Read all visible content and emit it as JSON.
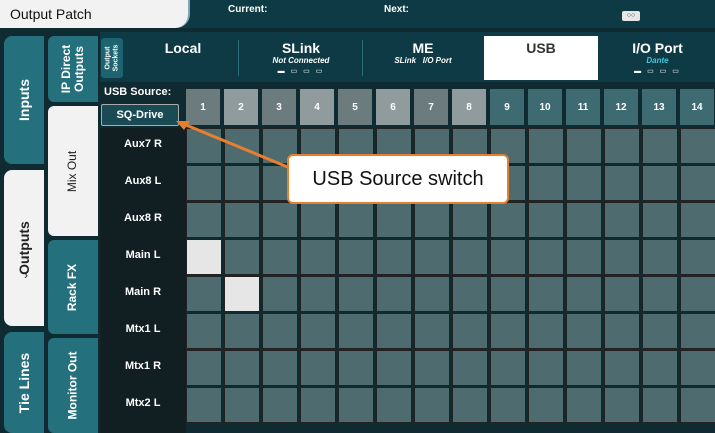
{
  "header": {
    "title": "Output Patch",
    "current_label": "Current:",
    "next_label": "Next:",
    "scene_icon": "scene-icon"
  },
  "main_tabs": [
    {
      "label": "Inputs",
      "active": false
    },
    {
      "label": "Outputs",
      "active": true
    },
    {
      "label": "Tie Lines",
      "active": false
    }
  ],
  "sub_tabs": [
    {
      "label": "IP Direct Outputs",
      "active": false
    },
    {
      "label": "Mix Out",
      "active": true
    },
    {
      "label": "Rack FX",
      "active": false
    },
    {
      "label": "Monitor Out",
      "active": false
    }
  ],
  "sockets_label": "Output Sockets",
  "socket_tabs": [
    {
      "name": "Local",
      "sub": "",
      "active": false
    },
    {
      "name": "SLink",
      "sub": "Not Connected",
      "active": false
    },
    {
      "name": "ME",
      "sub": "SLink   I/O Port",
      "active": false
    },
    {
      "name": "USB",
      "sub": "",
      "active": true
    },
    {
      "name": "I/O Port",
      "sub": "Dante",
      "active": false
    }
  ],
  "usb_source": {
    "label": "USB Source:",
    "value": "SQ-Drive"
  },
  "columns": [
    "1",
    "2",
    "3",
    "4",
    "5",
    "6",
    "7",
    "8",
    "9",
    "10",
    "11",
    "12",
    "13",
    "14"
  ],
  "rows": [
    "Aux7 R",
    "Aux8 L",
    "Aux8 R",
    "Main L",
    "Main R",
    "Mtx1 L",
    "Mtx1 R",
    "Mtx2 L"
  ],
  "patched": [
    [
      3,
      0
    ],
    [
      4,
      1
    ]
  ],
  "callout": "USB Source switch",
  "colors": {
    "callout_border": "#e87f2e",
    "patched_cell": "#e6e6e6",
    "grid_cell": "#4e6b70"
  }
}
